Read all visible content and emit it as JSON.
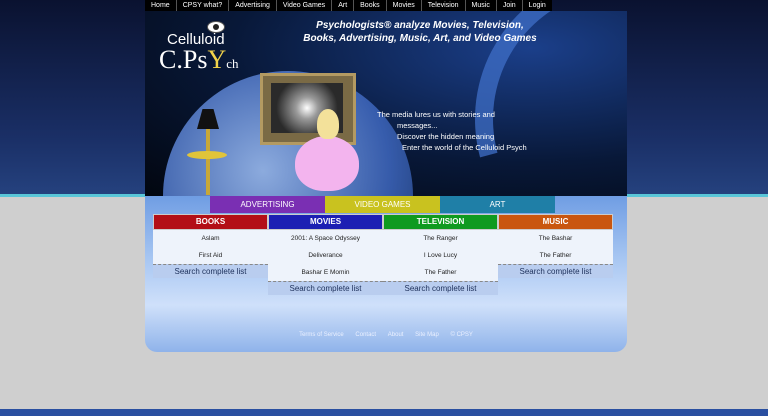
{
  "nav": [
    "Home",
    "CPSY what?",
    "Advertising",
    "Video Games",
    "Art",
    "Books",
    "Movies",
    "Television",
    "Music",
    "Join",
    "Login"
  ],
  "logo": {
    "top": "Celluloid",
    "bottom_c": "C.",
    "bottom_p": "P",
    "bottom_s": "s",
    "bottom_y": "Y",
    "bottom_ch": "ch"
  },
  "tagline": {
    "line1": "Psychologists® analyze Movies, Television,",
    "line2": "Books, Advertising, Music, Art, and Video Games"
  },
  "hero_text": [
    "The media lures us with stories and",
    "messages...",
    "Discover the hidden meaning",
    "Enter the world of the Celluloid Psych"
  ],
  "subtabs": [
    {
      "label": "ADVERTISING",
      "color": "#7a2fb3"
    },
    {
      "label": "VIDEO GAMES",
      "color": "#c9c21f"
    },
    {
      "label": "ART",
      "color": "#1f7fa7"
    }
  ],
  "categories": [
    {
      "title": "BOOKS",
      "color": "#b30f16",
      "items": [
        "Aslam",
        "First Aid"
      ],
      "search": "Search complete list"
    },
    {
      "title": "MOVIES",
      "color": "#1c1fb3",
      "items": [
        "2001: A Space Odyssey",
        "Deliverance",
        "Bashar E Momin"
      ],
      "search": "Search complete list"
    },
    {
      "title": "TELEVISION",
      "color": "#0f9a1f",
      "items": [
        "The Ranger",
        "I Love Lucy",
        "The Father"
      ],
      "search": "Search complete list"
    },
    {
      "title": "MUSIC",
      "color": "#c9560f",
      "items": [
        "The Bashar",
        "The Father"
      ],
      "search": "Search complete list"
    }
  ],
  "footer": [
    "Terms of Service",
    "Contact",
    "About",
    "Site Map",
    "© CPSY"
  ]
}
